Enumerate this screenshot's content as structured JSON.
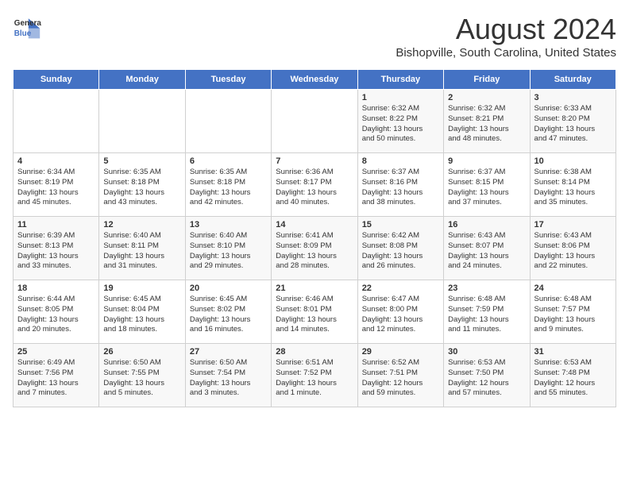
{
  "logo": {
    "line1": "General",
    "line2": "Blue"
  },
  "title": "August 2024",
  "subtitle": "Bishopville, South Carolina, United States",
  "days_of_week": [
    "Sunday",
    "Monday",
    "Tuesday",
    "Wednesday",
    "Thursday",
    "Friday",
    "Saturday"
  ],
  "weeks": [
    [
      {
        "day": "",
        "content": ""
      },
      {
        "day": "",
        "content": ""
      },
      {
        "day": "",
        "content": ""
      },
      {
        "day": "",
        "content": ""
      },
      {
        "day": "1",
        "content": "Sunrise: 6:32 AM\nSunset: 8:22 PM\nDaylight: 13 hours\nand 50 minutes."
      },
      {
        "day": "2",
        "content": "Sunrise: 6:32 AM\nSunset: 8:21 PM\nDaylight: 13 hours\nand 48 minutes."
      },
      {
        "day": "3",
        "content": "Sunrise: 6:33 AM\nSunset: 8:20 PM\nDaylight: 13 hours\nand 47 minutes."
      }
    ],
    [
      {
        "day": "4",
        "content": "Sunrise: 6:34 AM\nSunset: 8:19 PM\nDaylight: 13 hours\nand 45 minutes."
      },
      {
        "day": "5",
        "content": "Sunrise: 6:35 AM\nSunset: 8:18 PM\nDaylight: 13 hours\nand 43 minutes."
      },
      {
        "day": "6",
        "content": "Sunrise: 6:35 AM\nSunset: 8:18 PM\nDaylight: 13 hours\nand 42 minutes."
      },
      {
        "day": "7",
        "content": "Sunrise: 6:36 AM\nSunset: 8:17 PM\nDaylight: 13 hours\nand 40 minutes."
      },
      {
        "day": "8",
        "content": "Sunrise: 6:37 AM\nSunset: 8:16 PM\nDaylight: 13 hours\nand 38 minutes."
      },
      {
        "day": "9",
        "content": "Sunrise: 6:37 AM\nSunset: 8:15 PM\nDaylight: 13 hours\nand 37 minutes."
      },
      {
        "day": "10",
        "content": "Sunrise: 6:38 AM\nSunset: 8:14 PM\nDaylight: 13 hours\nand 35 minutes."
      }
    ],
    [
      {
        "day": "11",
        "content": "Sunrise: 6:39 AM\nSunset: 8:13 PM\nDaylight: 13 hours\nand 33 minutes."
      },
      {
        "day": "12",
        "content": "Sunrise: 6:40 AM\nSunset: 8:11 PM\nDaylight: 13 hours\nand 31 minutes."
      },
      {
        "day": "13",
        "content": "Sunrise: 6:40 AM\nSunset: 8:10 PM\nDaylight: 13 hours\nand 29 minutes."
      },
      {
        "day": "14",
        "content": "Sunrise: 6:41 AM\nSunset: 8:09 PM\nDaylight: 13 hours\nand 28 minutes."
      },
      {
        "day": "15",
        "content": "Sunrise: 6:42 AM\nSunset: 8:08 PM\nDaylight: 13 hours\nand 26 minutes."
      },
      {
        "day": "16",
        "content": "Sunrise: 6:43 AM\nSunset: 8:07 PM\nDaylight: 13 hours\nand 24 minutes."
      },
      {
        "day": "17",
        "content": "Sunrise: 6:43 AM\nSunset: 8:06 PM\nDaylight: 13 hours\nand 22 minutes."
      }
    ],
    [
      {
        "day": "18",
        "content": "Sunrise: 6:44 AM\nSunset: 8:05 PM\nDaylight: 13 hours\nand 20 minutes."
      },
      {
        "day": "19",
        "content": "Sunrise: 6:45 AM\nSunset: 8:04 PM\nDaylight: 13 hours\nand 18 minutes."
      },
      {
        "day": "20",
        "content": "Sunrise: 6:45 AM\nSunset: 8:02 PM\nDaylight: 13 hours\nand 16 minutes."
      },
      {
        "day": "21",
        "content": "Sunrise: 6:46 AM\nSunset: 8:01 PM\nDaylight: 13 hours\nand 14 minutes."
      },
      {
        "day": "22",
        "content": "Sunrise: 6:47 AM\nSunset: 8:00 PM\nDaylight: 13 hours\nand 12 minutes."
      },
      {
        "day": "23",
        "content": "Sunrise: 6:48 AM\nSunset: 7:59 PM\nDaylight: 13 hours\nand 11 minutes."
      },
      {
        "day": "24",
        "content": "Sunrise: 6:48 AM\nSunset: 7:57 PM\nDaylight: 13 hours\nand 9 minutes."
      }
    ],
    [
      {
        "day": "25",
        "content": "Sunrise: 6:49 AM\nSunset: 7:56 PM\nDaylight: 13 hours\nand 7 minutes."
      },
      {
        "day": "26",
        "content": "Sunrise: 6:50 AM\nSunset: 7:55 PM\nDaylight: 13 hours\nand 5 minutes."
      },
      {
        "day": "27",
        "content": "Sunrise: 6:50 AM\nSunset: 7:54 PM\nDaylight: 13 hours\nand 3 minutes."
      },
      {
        "day": "28",
        "content": "Sunrise: 6:51 AM\nSunset: 7:52 PM\nDaylight: 13 hours\nand 1 minute."
      },
      {
        "day": "29",
        "content": "Sunrise: 6:52 AM\nSunset: 7:51 PM\nDaylight: 12 hours\nand 59 minutes."
      },
      {
        "day": "30",
        "content": "Sunrise: 6:53 AM\nSunset: 7:50 PM\nDaylight: 12 hours\nand 57 minutes."
      },
      {
        "day": "31",
        "content": "Sunrise: 6:53 AM\nSunset: 7:48 PM\nDaylight: 12 hours\nand 55 minutes."
      }
    ]
  ]
}
